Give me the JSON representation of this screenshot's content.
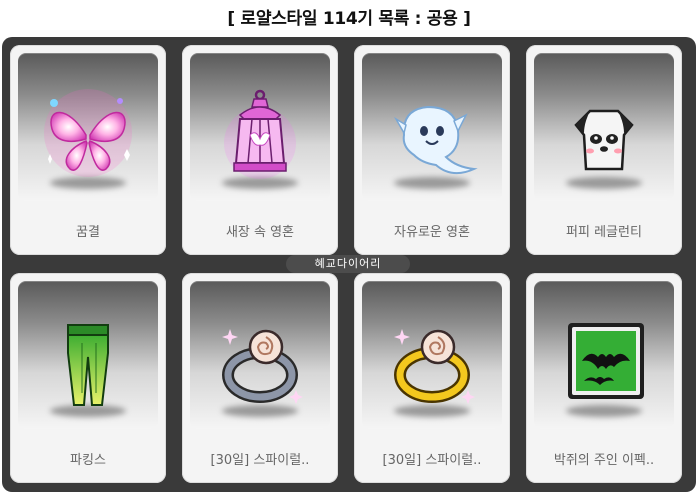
{
  "title": "[ 로얄스타일 114기 목록 : 공용 ]",
  "watermark": "혜교다이어리",
  "items": [
    {
      "label": "꿈결",
      "icon": "butterfly-wings-icon"
    },
    {
      "label": "새장 속 영혼",
      "icon": "birdcage-lantern-icon"
    },
    {
      "label": "자유로운 영혼",
      "icon": "ghost-icon"
    },
    {
      "label": "퍼피 레글런티",
      "icon": "puppy-tshirt-icon"
    },
    {
      "label": "파킹스",
      "icon": "green-leggings-icon"
    },
    {
      "label": "[30일] 스파이럴..",
      "icon": "silver-spiral-ring-icon"
    },
    {
      "label": "[30일] 스파이럴..",
      "icon": "gold-spiral-ring-icon"
    },
    {
      "label": "박쥐의 주인 이펙..",
      "icon": "bat-effect-icon"
    }
  ],
  "colors": {
    "frame": "#3a3a3a",
    "card": "#f4f4f4",
    "label": "#666666"
  }
}
